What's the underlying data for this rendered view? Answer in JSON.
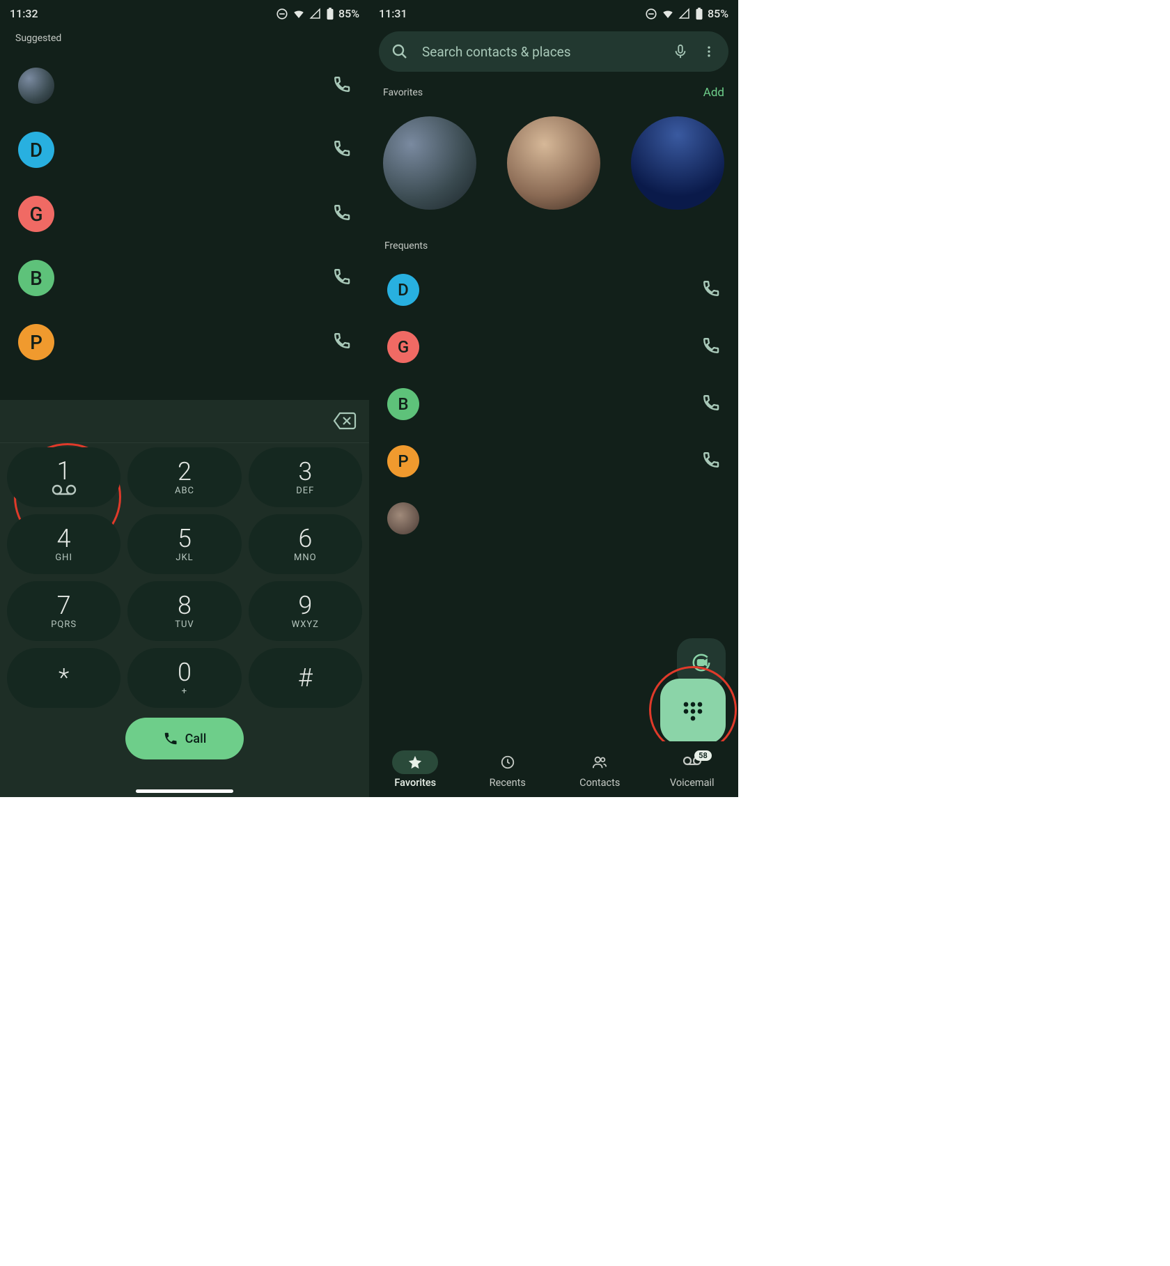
{
  "left": {
    "status": {
      "time": "11:32",
      "battery": "85%"
    },
    "suggested_label": "Suggested",
    "contacts": [
      {
        "letter": "",
        "cls": "av-photo1"
      },
      {
        "letter": "D",
        "cls": "av-D"
      },
      {
        "letter": "G",
        "cls": "av-G"
      },
      {
        "letter": "B",
        "cls": "av-B"
      },
      {
        "letter": "P",
        "cls": "av-P"
      }
    ],
    "keys": [
      {
        "num": "1",
        "sub": "",
        "vm": true
      },
      {
        "num": "2",
        "sub": "ABC"
      },
      {
        "num": "3",
        "sub": "DEF"
      },
      {
        "num": "4",
        "sub": "GHI"
      },
      {
        "num": "5",
        "sub": "JKL"
      },
      {
        "num": "6",
        "sub": "MNO"
      },
      {
        "num": "7",
        "sub": "PQRS"
      },
      {
        "num": "8",
        "sub": "TUV"
      },
      {
        "num": "9",
        "sub": "WXYZ"
      },
      {
        "num": "*",
        "sub": ""
      },
      {
        "num": "0",
        "sub": "+"
      },
      {
        "num": "#",
        "sub": ""
      }
    ],
    "call_label": "Call"
  },
  "right": {
    "status": {
      "time": "11:31",
      "battery": "85%"
    },
    "search_placeholder": "Search contacts & places",
    "favorites_label": "Favorites",
    "add_label": "Add",
    "frequents_label": "Frequents",
    "frequents": [
      {
        "letter": "D",
        "cls": "av-D"
      },
      {
        "letter": "G",
        "cls": "av-G"
      },
      {
        "letter": "B",
        "cls": "av-B"
      },
      {
        "letter": "P",
        "cls": "av-P"
      },
      {
        "letter": "",
        "cls": "av-photo4"
      }
    ],
    "nav": {
      "favorites": "Favorites",
      "recents": "Recents",
      "contacts": "Contacts",
      "voicemail": "Voicemail",
      "vm_badge": "58"
    }
  }
}
